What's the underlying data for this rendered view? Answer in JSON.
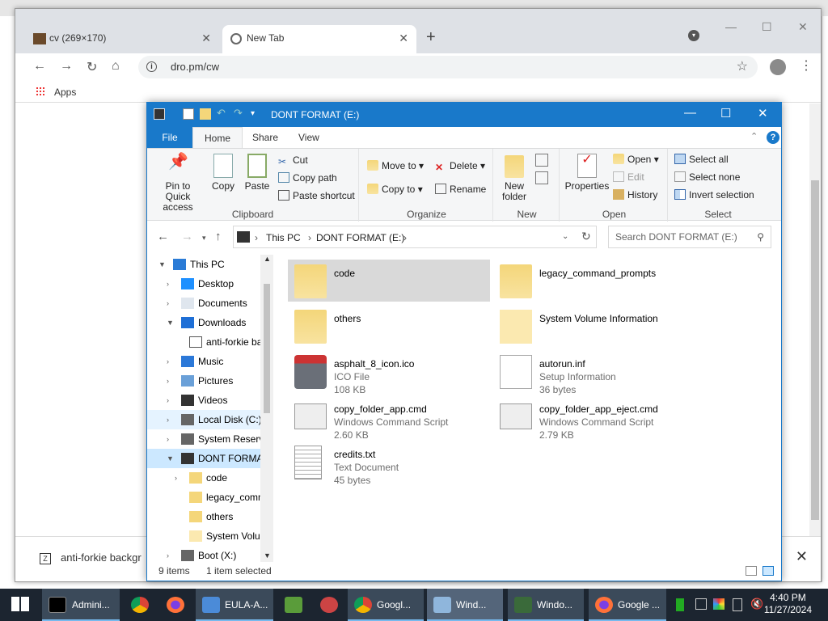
{
  "browser": {
    "tabs": [
      {
        "label": "cv (269×170)",
        "close": "✕"
      },
      {
        "label": "New Tab",
        "close": "✕"
      }
    ],
    "new_tab": "+",
    "address": "dro.pm/cw",
    "bookmarks": {
      "apps": "Apps"
    },
    "download_item": "anti-forkie backgr",
    "download_close": "✕"
  },
  "explorer": {
    "title": "DONT FORMAT (E:)",
    "ribbon_tabs": [
      "File",
      "Home",
      "Share",
      "View"
    ],
    "clipboard": {
      "pin": "Pin to Quick access",
      "copy": "Copy",
      "paste": "Paste",
      "cut": "Cut",
      "copy_path": "Copy path",
      "paste_shortcut": "Paste shortcut",
      "label": "Clipboard"
    },
    "organize": {
      "move_to": "Move to",
      "copy_to": "Copy to",
      "delete": "Delete",
      "rename": "Rename",
      "label": "Organize"
    },
    "new": {
      "new_folder": "New folder",
      "label": "New"
    },
    "open": {
      "properties": "Properties",
      "open": "Open",
      "edit": "Edit",
      "history": "History",
      "label": "Open"
    },
    "select": {
      "select_all": "Select all",
      "select_none": "Select none",
      "invert": "Invert selection",
      "label": "Select"
    },
    "breadcrumb": [
      "This PC",
      "DONT FORMAT (E:)"
    ],
    "search_placeholder": "Search DONT FORMAT (E:)",
    "tree": [
      "This PC",
      "Desktop",
      "Documents",
      "Downloads",
      "anti-forkie ba",
      "Music",
      "Pictures",
      "Videos",
      "Local Disk (C:)",
      "System Reserve",
      "DONT FORMAT",
      "code",
      "legacy_comm",
      "others",
      "System Volun",
      "Boot (X:)"
    ],
    "files": [
      {
        "name": "code",
        "line1": "",
        "line2": ""
      },
      {
        "name": "legacy_command_prompts",
        "line1": "",
        "line2": ""
      },
      {
        "name": "others",
        "line1": "",
        "line2": ""
      },
      {
        "name": "System Volume Information",
        "line1": "",
        "line2": ""
      },
      {
        "name": "asphalt_8_icon.ico",
        "line1": "ICO File",
        "line2": "108 KB"
      },
      {
        "name": "autorun.inf",
        "line1": "Setup Information",
        "line2": "36 bytes"
      },
      {
        "name": "copy_folder_app.cmd",
        "line1": "Windows Command Script",
        "line2": "2.60 KB"
      },
      {
        "name": "copy_folder_app_eject.cmd",
        "line1": "Windows Command Script",
        "line2": "2.79 KB"
      },
      {
        "name": "credits.txt",
        "line1": "Text Document",
        "line2": "45 bytes"
      }
    ],
    "status": {
      "count": "9 items",
      "selected": "1 item selected"
    }
  },
  "taskbar": {
    "items": [
      "Admini...",
      "EULA-A...",
      "Googl...",
      "Wind...",
      "Windo...",
      "Google ..."
    ],
    "time": "4:40 PM",
    "date": "11/27/2024"
  },
  "colors": {
    "accent": "#1979ca",
    "taskbar": "#1c2530",
    "folder": "#f4d67a"
  }
}
